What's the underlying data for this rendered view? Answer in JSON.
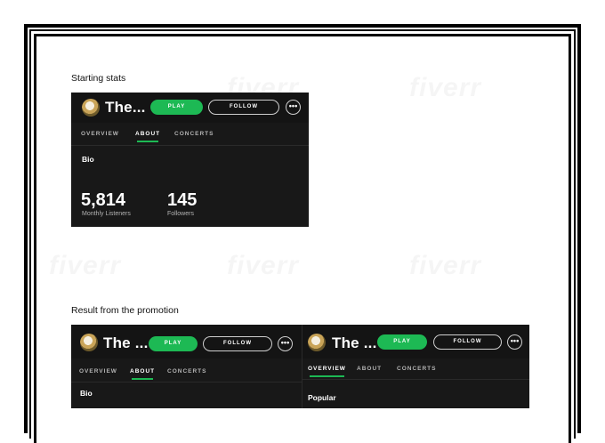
{
  "captions": {
    "starting": "Starting stats",
    "result": "Result from the promotion"
  },
  "panel1": {
    "artist": "The...",
    "play": "PLAY",
    "follow": "FOLLOW",
    "more": "•••",
    "tabs": [
      "OVERVIEW",
      "ABOUT",
      "CONCERTS"
    ],
    "active_tab": "ABOUT",
    "section": "Bio",
    "stats": [
      {
        "value": "5,814",
        "label": "Monthly Listeners"
      },
      {
        "value": "145",
        "label": "Followers"
      }
    ]
  },
  "panel2": {
    "artist": "The ...",
    "play": "PLAY",
    "follow": "FOLLOW",
    "more": "•••",
    "tabs": [
      "OVERVIEW",
      "ABOUT",
      "CONCERTS"
    ],
    "active_tab": "ABOUT",
    "section": "Bio"
  },
  "panel3": {
    "artist": "The ...",
    "play": "PLAY",
    "follow": "FOLLOW",
    "more": "•••",
    "tabs": [
      "OVERVIEW",
      "ABOUT",
      "CONCERTS"
    ],
    "active_tab": "OVERVIEW",
    "section": "Popular"
  },
  "colors": {
    "accent": "#1db954",
    "panel_bg": "#181818",
    "header_bg": "#141414"
  },
  "watermark": "fiverr"
}
